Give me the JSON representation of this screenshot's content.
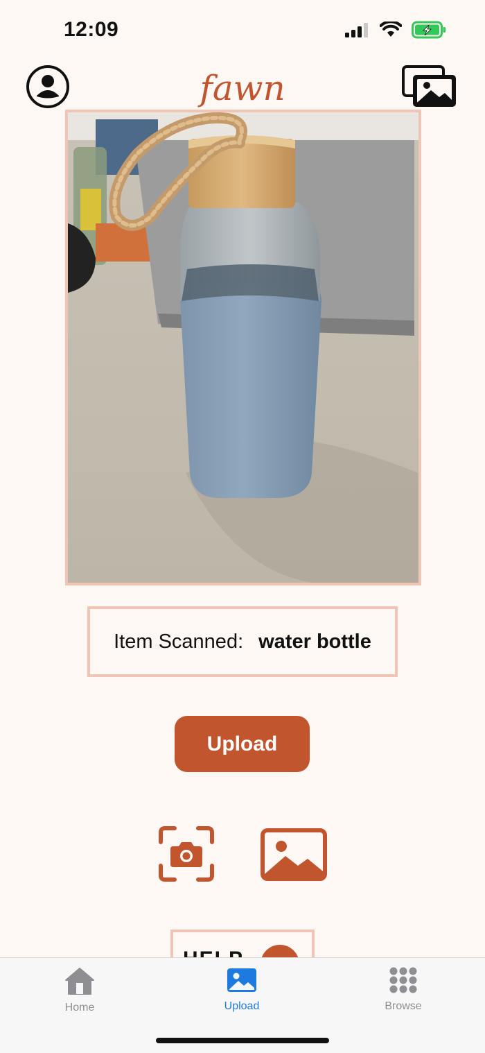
{
  "status_bar": {
    "time": "12:09",
    "battery_color": "#34c759"
  },
  "header": {
    "brand": "fawn",
    "profile_icon": "person-circle-icon",
    "gallery_icon": "photo-stack-icon"
  },
  "photo": {
    "subject": "water-bottle-photo"
  },
  "scan": {
    "label": "Item Scanned:",
    "value": "water bottle"
  },
  "upload_button": {
    "label": "Upload"
  },
  "actions": {
    "camera_icon": "camera-scan-icon",
    "gallery_icon": "image-icon"
  },
  "help_peek": {
    "text": "HELP"
  },
  "tabs": [
    {
      "label": "Home",
      "icon": "house-icon"
    },
    {
      "label": "Upload",
      "icon": "photo-icon"
    },
    {
      "label": "Browse",
      "icon": "grid-dots-icon"
    }
  ],
  "colors": {
    "accent": "#c0552e",
    "frame": "#efc5b5",
    "background": "#fdf8f4",
    "active_tab": "#1f7ae0"
  }
}
